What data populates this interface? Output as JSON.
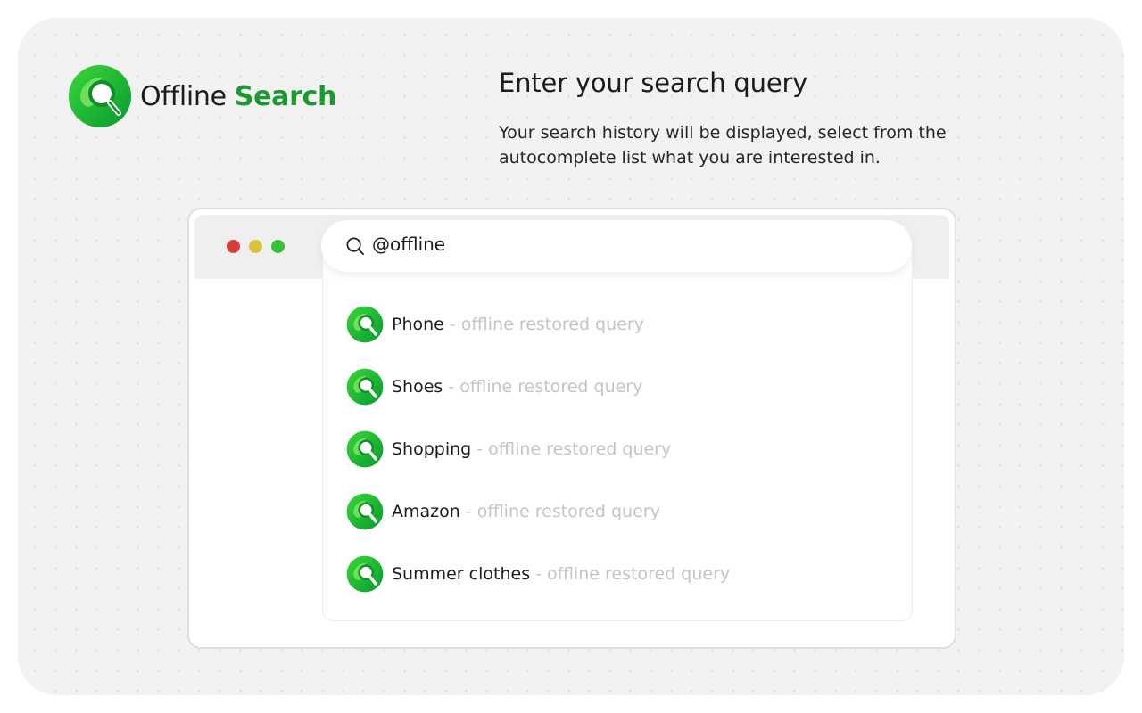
{
  "brand": {
    "name_part1": "Offline",
    "name_part2": "Search",
    "accent_color": "#1a9a2c",
    "logo_icon": "magnifier-logo-icon"
  },
  "intro": {
    "heading": "Enter your search query",
    "description": "Your search history will be displayed, select from the autocomplete list what you are interested in."
  },
  "browser": {
    "window_controls": [
      "close",
      "minimize",
      "maximize"
    ],
    "search": {
      "icon": "search-icon",
      "query": "@offline"
    },
    "suggestions": [
      {
        "term": "Phone",
        "note": "- offline restored query"
      },
      {
        "term": "Shoes",
        "note": "- offline restored query"
      },
      {
        "term": "Shopping",
        "note": "- offline restored query"
      },
      {
        "term": "Amazon",
        "note": "- offline restored query"
      },
      {
        "term": "Summer clothes",
        "note": "- offline restored query"
      }
    ]
  }
}
